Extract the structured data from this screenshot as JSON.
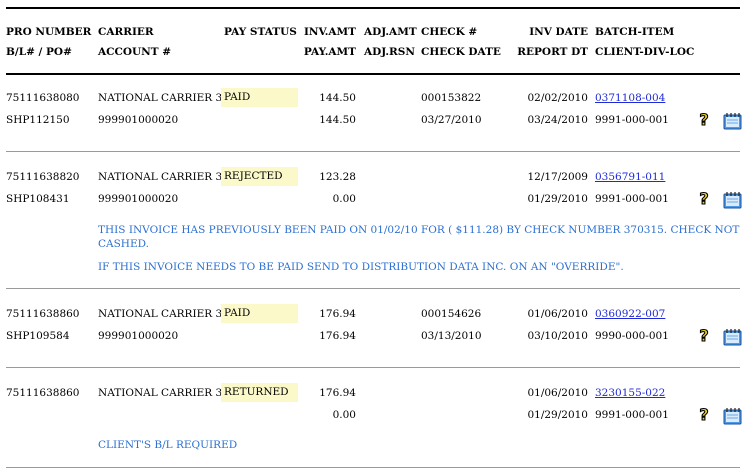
{
  "header": {
    "pro_number": "PRO NUMBER",
    "bl_po": "B/L# / PO#",
    "carrier": "CARRIER",
    "account": "ACCOUNT #",
    "pay_status": "PAY STATUS",
    "inv_amt": "INV.AMT",
    "pay_amt": "PAY.AMT",
    "adj_amt": "ADJ.AMT",
    "adj_rsn": "ADJ.RSN",
    "check_no": "CHECK #",
    "check_date": "CHECK DATE",
    "inv_date": "INV DATE",
    "report_dt": "REPORT DT",
    "batch_item": "BATCH-ITEM",
    "client_div_loc": "CLIENT-DIV-LOC"
  },
  "rows": [
    {
      "pro": "75111638080",
      "bl": "SHP112150",
      "carrier": "NATIONAL CARRIER 3",
      "account": "999901000020",
      "status": "PAID",
      "inv_amt": "144.50",
      "pay_amt": "144.50",
      "check_no": "000153822",
      "check_date": "03/27/2010",
      "inv_date": "02/02/2010",
      "report_dt": "03/24/2010",
      "batch": "0371108-004",
      "client": "9991-000-001"
    },
    {
      "pro": "75111638820",
      "bl": "SHP108431",
      "carrier": "NATIONAL CARRIER 3",
      "account": "999901000020",
      "status": "REJECTED",
      "inv_amt": "123.28",
      "pay_amt": "0.00",
      "check_no": "",
      "check_date": "",
      "inv_date": "12/17/2009",
      "report_dt": "01/29/2010",
      "batch": "0356791-011",
      "client": "9991-000-001",
      "messages": [
        "THIS INVOICE HAS PREVIOUSLY BEEN PAID ON 01/02/10 FOR ( $111.28) BY CHECK NUMBER 370315. CHECK NOT",
        "CASHED.",
        "IF THIS INVOICE NEEDS TO BE PAID SEND TO DISTRIBUTION DATA INC. ON AN \"OVERRIDE\"."
      ]
    },
    {
      "pro": "75111638860",
      "bl": "SHP109584",
      "carrier": "NATIONAL CARRIER 3",
      "account": "999901000020",
      "status": "PAID",
      "inv_amt": "176.94",
      "pay_amt": "176.94",
      "check_no": "000154626",
      "check_date": "03/13/2010",
      "inv_date": "01/06/2010",
      "report_dt": "03/10/2010",
      "batch": "0360922-007",
      "client": "9990-000-001"
    },
    {
      "pro": "75111638860",
      "bl": "",
      "carrier": "NATIONAL CARRIER 3",
      "account": "",
      "status": "RETURNED",
      "inv_amt": "176.94",
      "pay_amt": "0.00",
      "check_no": "",
      "check_date": "",
      "inv_date": "01/06/2010",
      "report_dt": "01/29/2010",
      "batch": "3230155-022",
      "client": "9991-000-001",
      "messages": [
        "CLIENT'S B/L REQUIRED"
      ]
    }
  ],
  "icons": {
    "help": "question-mark-icon",
    "notes": "notepad-icon"
  },
  "colors": {
    "status_bg": "#fbf9c9",
    "link": "#1f2ad6",
    "message": "#2b6fd1"
  }
}
